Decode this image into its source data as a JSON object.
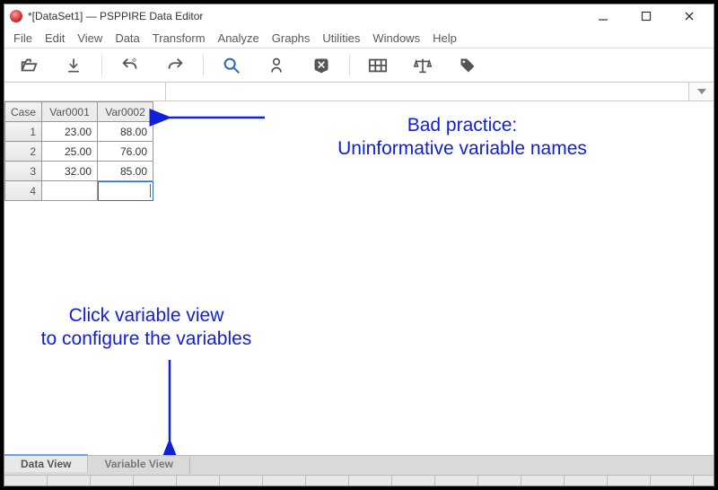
{
  "title": "*[DataSet1] — PSPPIRE Data Editor",
  "menu": [
    "File",
    "Edit",
    "View",
    "Data",
    "Transform",
    "Analyze",
    "Graphs",
    "Utilities",
    "Windows",
    "Help"
  ],
  "toolbar_icons": [
    "open-icon",
    "save-icon",
    "undo-icon",
    "redo-icon",
    "search-icon",
    "info-icon",
    "close-x-icon",
    "grid-icon",
    "scales-icon",
    "tag-icon"
  ],
  "columns": [
    "Case",
    "Var0001",
    "Var0002"
  ],
  "rows": [
    {
      "case": "1",
      "v1": "23.00",
      "v2": "88.00"
    },
    {
      "case": "2",
      "v1": "25.00",
      "v2": "76.00"
    },
    {
      "case": "3",
      "v1": "32.00",
      "v2": "85.00"
    },
    {
      "case": "4",
      "v1": "",
      "v2": ""
    }
  ],
  "tabs": {
    "data": "Data View",
    "variable": "Variable View"
  },
  "annotations": {
    "top": "Bad practice:\nUninformative variable names",
    "left": "Click variable view\nto configure the variables"
  },
  "colors": {
    "annotation": "#1020d8"
  }
}
